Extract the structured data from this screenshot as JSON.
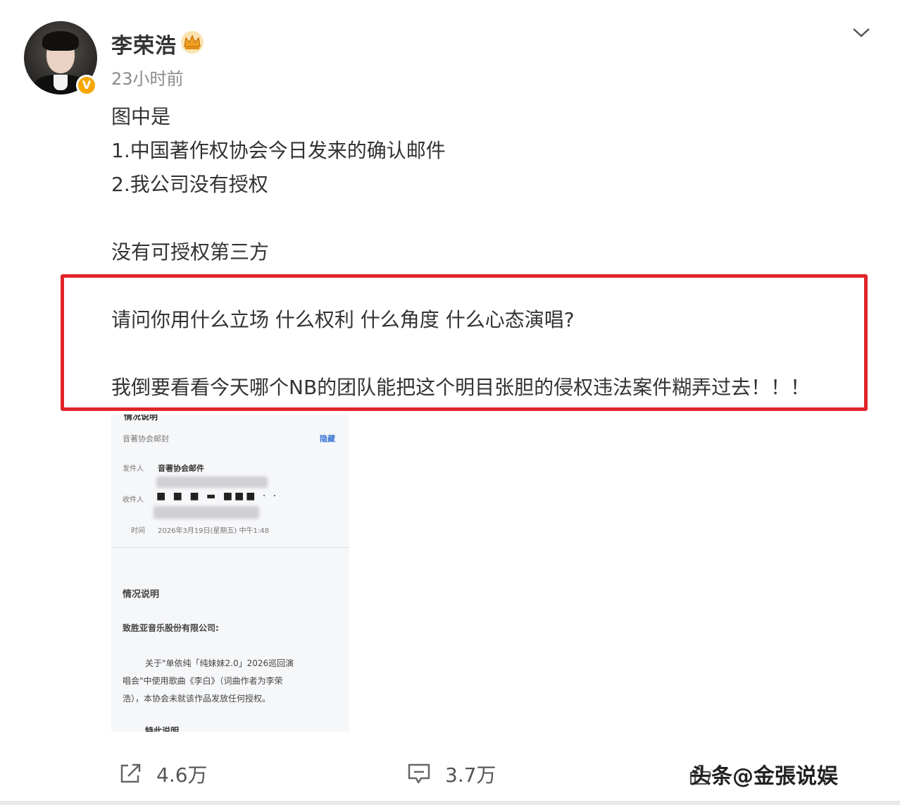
{
  "post": {
    "author": "李荣浩",
    "timestamp": "23小时前",
    "lines": [
      "图中是",
      "1.中国著作权协会今日发来的确认邮件",
      "2.我公司没有授权",
      "没有可授权第三方",
      "请问你用什么立场 什么权利 什么角度 什么心态演唱?",
      "我倒要看看今天哪个NB的团队能把这个明目张胆的侵权违法案件糊弄过去！！！"
    ],
    "highlight_color": "#e0252b"
  },
  "document_image": {
    "header_partial": "情况说明",
    "sender_org": "音著协会邮封",
    "hide_link": "隐藏",
    "sender_label": "发件人",
    "sender_value": "音著协会邮件",
    "recipient_label": "收件人",
    "time_label": "时间",
    "time_value": "2026年3月19日(星期五) 中午1:48",
    "heading": "情况说明",
    "addressee": "致胜亚音乐股份有限公司:",
    "body": [
      "关于\"单依纯「纯妹妹2.0」2026巡回演",
      "唱会\"中使用歌曲《李白》（词曲作者为李荣",
      "浩），本协会未就该作品发放任何授权。"
    ],
    "footer_partial": "特此说明"
  },
  "actions": {
    "repost_count": "4.6万",
    "comment_count": "3.7万"
  },
  "watermark": "头条@金張说娱",
  "icons": {
    "avatar": "avatar",
    "verified": "verified-badge-icon",
    "crown": "crown-icon",
    "more": "chevron-down-icon",
    "repost": "repost-icon",
    "comment": "comment-icon",
    "like": "thumbs-up-icon"
  }
}
